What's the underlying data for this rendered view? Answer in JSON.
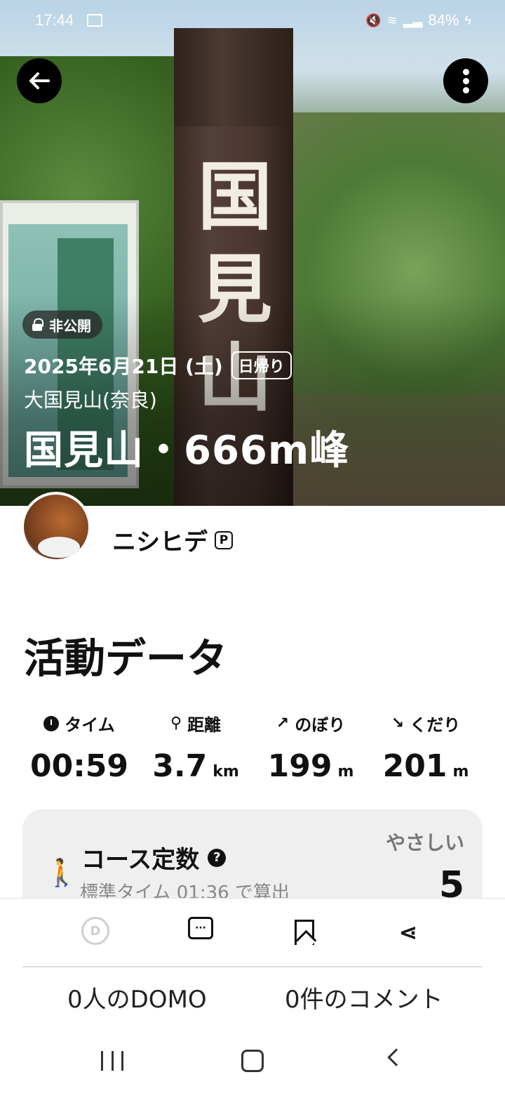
{
  "status_bar": {
    "time": "17:44",
    "battery": "84%"
  },
  "hero": {
    "post_chars": [
      "国",
      "見",
      "山"
    ],
    "visibility": "非公開",
    "date": "2025年6月21日 (土)",
    "trip_type": "日帰り",
    "area": "大国見山(奈良)",
    "title": "国見山・666m峰"
  },
  "user": {
    "name": "ニシヒデ",
    "plan_badge": "P"
  },
  "activity": {
    "section_title": "活動データ",
    "stats": [
      {
        "label": "タイム",
        "value": "00:59",
        "unit": "",
        "icon": "timer-icon"
      },
      {
        "label": "距離",
        "value": "3.7",
        "unit": "km",
        "icon": "route-icon"
      },
      {
        "label": "のぼり",
        "value": "199",
        "unit": "m",
        "icon": "ascent-icon"
      },
      {
        "label": "くだり",
        "value": "201",
        "unit": "m",
        "icon": "descent-icon"
      }
    ]
  },
  "course": {
    "title": "コース定数",
    "subtitle": "標準タイム 01:36 で算出",
    "level": "やさしい",
    "value": "5"
  },
  "actions": {
    "domo_count": "0人のDOMO",
    "comment_count": "0件のコメント",
    "domo_icon_letter": "D"
  }
}
